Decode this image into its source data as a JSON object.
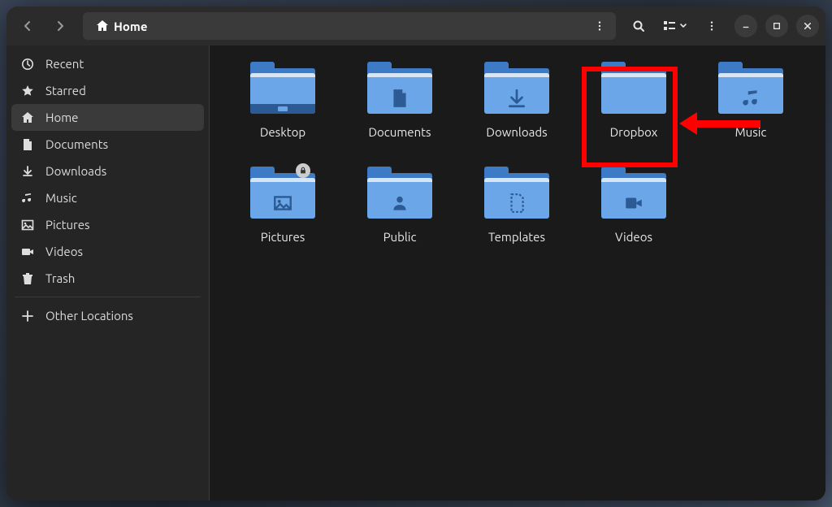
{
  "header": {
    "path_label": "Home"
  },
  "sidebar": {
    "items": [
      {
        "label": "Recent",
        "icon": "clock-icon"
      },
      {
        "label": "Starred",
        "icon": "star-icon"
      },
      {
        "label": "Home",
        "icon": "home-icon",
        "active": true
      },
      {
        "label": "Documents",
        "icon": "document-icon"
      },
      {
        "label": "Downloads",
        "icon": "download-icon"
      },
      {
        "label": "Music",
        "icon": "music-icon"
      },
      {
        "label": "Pictures",
        "icon": "pictures-icon"
      },
      {
        "label": "Videos",
        "icon": "videos-icon"
      },
      {
        "label": "Trash",
        "icon": "trash-icon"
      }
    ],
    "other_locations_label": "Other Locations"
  },
  "folders": [
    {
      "label": "Desktop",
      "glyph": "desktop"
    },
    {
      "label": "Documents",
      "glyph": "document"
    },
    {
      "label": "Downloads",
      "glyph": "download"
    },
    {
      "label": "Dropbox",
      "glyph": "none",
      "highlighted": true
    },
    {
      "label": "Music",
      "glyph": "music"
    },
    {
      "label": "Pictures",
      "glyph": "picture",
      "locked": true
    },
    {
      "label": "Public",
      "glyph": "public"
    },
    {
      "label": "Templates",
      "glyph": "template"
    },
    {
      "label": "Videos",
      "glyph": "video"
    }
  ],
  "annotation": {
    "highlight_target": "Dropbox",
    "arrow_color": "#ff0000"
  },
  "colors": {
    "folder_light": "#6ba6e8",
    "folder_dark": "#3d7bc6",
    "folder_glyph": "#2c5a94",
    "window_bg": "#1a1a1a"
  }
}
